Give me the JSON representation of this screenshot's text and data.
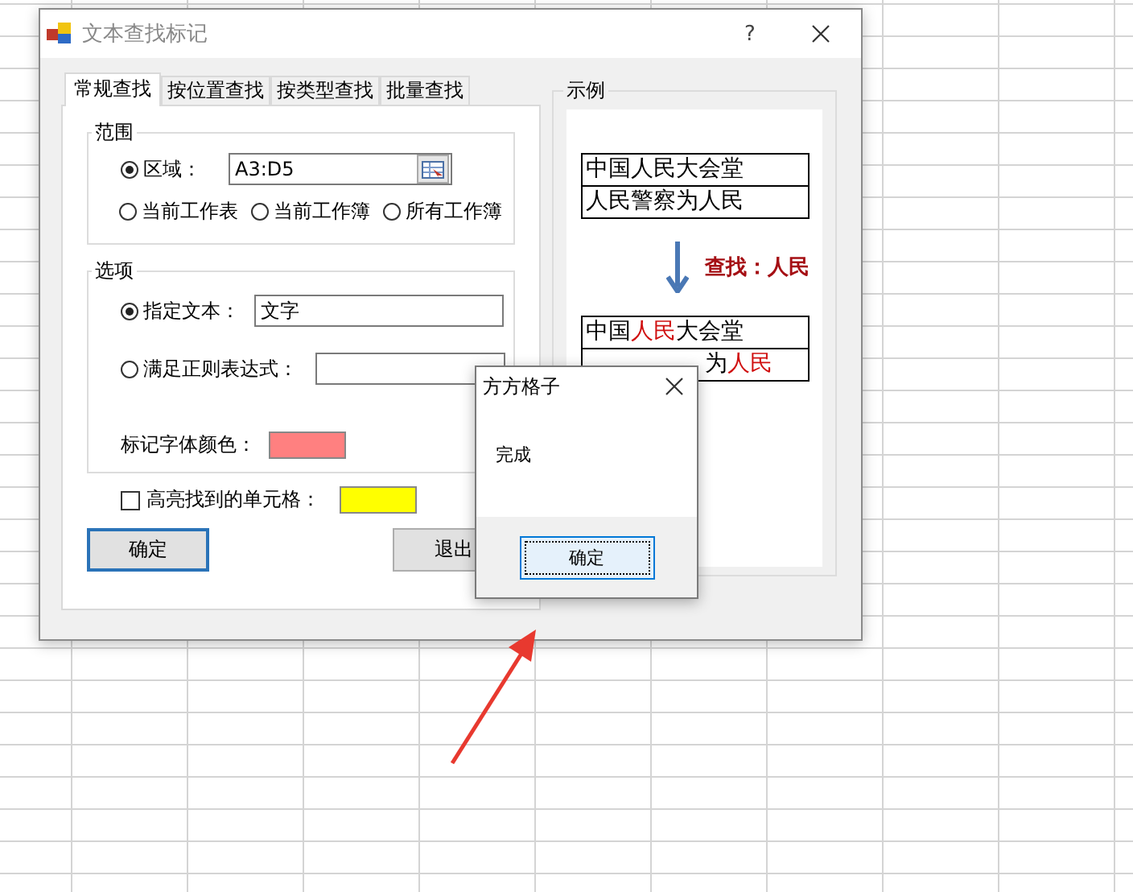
{
  "window": {
    "title": "文本查找标记",
    "help": "?"
  },
  "tabs": [
    {
      "label": "常规查找",
      "selected": true
    },
    {
      "label": "按位置查找",
      "selected": false
    },
    {
      "label": "按类型查找",
      "selected": false
    },
    {
      "label": "批量查找",
      "selected": false
    }
  ],
  "scope": {
    "title": "范围",
    "area": {
      "label": "区域：",
      "value": "A3:D5",
      "selected": true
    },
    "options": [
      {
        "label": "当前工作表",
        "selected": false
      },
      {
        "label": "当前工作簿",
        "selected": false
      },
      {
        "label": "所有工作簿",
        "selected": false
      }
    ]
  },
  "options": {
    "title": "选项",
    "specified": {
      "label": "指定文本：",
      "value": "文字",
      "selected": true
    },
    "regex": {
      "label": "满足正则表达式：",
      "selected": false
    },
    "font_color": {
      "label": "标记字体颜色：",
      "color": "#ff8080"
    }
  },
  "highlight": {
    "label": "高亮找到的单元格：",
    "checked": false,
    "color": "#ffff00"
  },
  "buttons": [
    {
      "label": "确定",
      "default": true
    },
    {
      "label": "退出",
      "default": false
    }
  ],
  "example": {
    "title": "示例",
    "before": [
      "中国人民大会堂",
      "人民警察为人民"
    ],
    "search_label": "查找：人民",
    "after": [
      [
        {
          "text": "中国",
          "highlight": false
        },
        {
          "text": "人民",
          "highlight": true
        },
        {
          "text": "大会堂",
          "highlight": false
        }
      ],
      [
        {
          "text": "为",
          "highlight": false
        },
        {
          "text": "人民",
          "highlight": true
        }
      ]
    ]
  },
  "message_box": {
    "title": "方方格子",
    "message": "完成",
    "button": "确定"
  }
}
